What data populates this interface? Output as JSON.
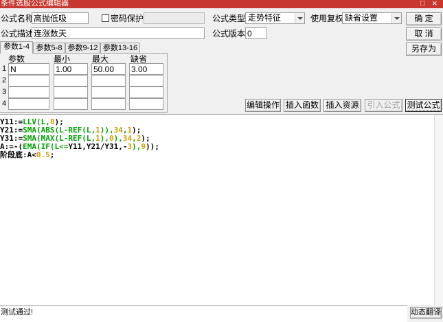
{
  "window": {
    "title": "条件选股公式编辑器",
    "maximize_glyph": "□",
    "close_glyph": "×"
  },
  "form": {
    "name": {
      "label": "公式名称",
      "value": "高抛低吸"
    },
    "password": {
      "label": "密码保护",
      "checked": false
    },
    "formula_type": {
      "label": "公式类型",
      "value": "走势特征"
    },
    "adjustment": {
      "label": "使用复权",
      "value": "缺省设置"
    },
    "description": {
      "label": "公式描述",
      "value": "连涨数天"
    },
    "version": {
      "label": "公式版本",
      "value": "0"
    }
  },
  "dialog_buttons": {
    "ok": "确 定",
    "cancel": "取 消",
    "save_as": "另存为"
  },
  "tabs": [
    {
      "label": "参数1-4",
      "active": true
    },
    {
      "label": "参数5-8",
      "active": false
    },
    {
      "label": "参数9-12",
      "active": false
    },
    {
      "label": "参数13-16",
      "active": false
    }
  ],
  "params": {
    "headers": [
      "参数",
      "最小",
      "最大",
      "缺省"
    ],
    "rows": [
      {
        "index": "1",
        "values": [
          "N",
          "1.00",
          "50.00",
          "3.00"
        ]
      },
      {
        "index": "2",
        "values": [
          "",
          "",
          "",
          ""
        ]
      },
      {
        "index": "3",
        "values": [
          "",
          "",
          "",
          ""
        ]
      },
      {
        "index": "4",
        "values": [
          "",
          "",
          "",
          ""
        ]
      }
    ]
  },
  "actions": [
    {
      "label": "编辑操作",
      "enabled": true,
      "focused": false
    },
    {
      "label": "插入函数",
      "enabled": true,
      "focused": false
    },
    {
      "label": "插入资源",
      "enabled": true,
      "focused": false
    },
    {
      "label": "引入公式",
      "enabled": false,
      "focused": false
    },
    {
      "label": "测试公式",
      "enabled": true,
      "focused": true
    }
  ],
  "code": {
    "lines": [
      [
        {
          "plain": "Y11:="
        },
        {
          "func": "LLV(L,"
        },
        {
          "num": "8"
        },
        {
          "plain": ");"
        }
      ],
      [
        {
          "plain": "Y21:="
        },
        {
          "func": "SMA(ABS(L-REF(L,"
        },
        {
          "num": "1"
        },
        {
          "func": ")),"
        },
        {
          "num": "34"
        },
        {
          "func": ","
        },
        {
          "num": "1"
        },
        {
          "plain": ");"
        }
      ],
      [
        {
          "plain": "Y31:="
        },
        {
          "func": "SMA(MAX(L-REF(L,"
        },
        {
          "num": "1"
        },
        {
          "func": "),"
        },
        {
          "num": "0"
        },
        {
          "func": "),"
        },
        {
          "num": "34"
        },
        {
          "func": ","
        },
        {
          "num": "2"
        },
        {
          "plain": ");"
        }
      ],
      [
        {
          "plain": "A:=-("
        },
        {
          "func": "EMA(IF(L<="
        },
        {
          "plain": "Y11,Y21/Y31,-"
        },
        {
          "num": "3"
        },
        {
          "func": "),"
        },
        {
          "num": "9"
        },
        {
          "plain": "));"
        }
      ],
      [
        {
          "plain": "阶段底:A<"
        },
        {
          "num": "0.5"
        },
        {
          "plain": ";"
        }
      ]
    ]
  },
  "status": {
    "message": "测试通过!",
    "translate_button": "动态翻译"
  },
  "colors": {
    "title_bar": "#c7372f",
    "code_plain": "#000000",
    "code_function": "#00a000",
    "code_number": "#d09c00",
    "disabled_text": "#a0a0a0"
  }
}
